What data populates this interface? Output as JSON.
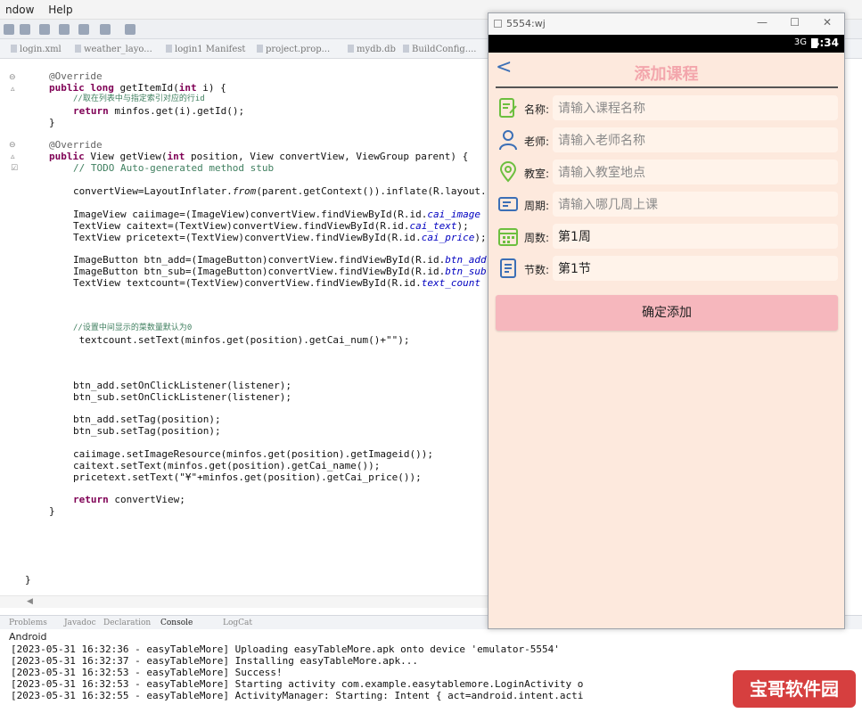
{
  "menu": [
    "ndow",
    "Help"
  ],
  "editor_tabs": [
    "login.xml",
    "weather_layo...",
    "login1 Manifest",
    "project.prop...",
    "mydb.db",
    "BuildConfig...."
  ],
  "code": {
    "l1": "@Override",
    "l2a": "public long ",
    "l2b": "getItemId(",
    "l2c": "int",
    "l2d": " i) {",
    "l3": "//取在列表中与指定索引对应的行id",
    "l4a": "return",
    "l4b": " minfos.get(i).getId();",
    "l5": "}",
    "l6": "@Override",
    "l7a": "public",
    "l7b": " View getView(",
    "l7c": "int",
    "l7d": " position, View convertView, ViewGroup parent) {",
    "l8": "// TODO Auto-generated method stub",
    "l9a": "convertView=LayoutInflater.",
    "l9b": "from",
    "l9c": "(parent.getContext()).inflate(R.layout.",
    "l10a": "ImageView caiimage=(ImageView)convertView.findViewById(R.id.",
    "l10b": "cai_image",
    "l11a": "TextView caitext=(TextView)convertView.findViewById(R.id.",
    "l11b": "cai_text",
    "l11c": ");",
    "l12a": "TextView pricetext=(TextView)convertView.findViewById(R.id.",
    "l12b": "cai_price",
    "l12c": ");",
    "l13a": "ImageButton btn_add=(ImageButton)convertView.findViewById(R.id.",
    "l13b": "btn_add",
    "l14a": "ImageButton btn_sub=(ImageButton)convertView.findViewById(R.id.",
    "l14b": "btn_sub",
    "l15a": "TextView textcount=(TextView)convertView.findViewById(R.id.",
    "l15b": "text_count",
    "l16": "//设置中间显示的菜数量默认为0",
    "l17": " textcount.setText(minfos.get(position).getCai_num()+\"\");",
    "l18": "btn_add.setOnClickListener(listener);",
    "l19": "btn_sub.setOnClickListener(listener);",
    "l20": "btn_add.setTag(position);",
    "l21": "btn_sub.setTag(position);",
    "l22": "caiimage.setImageResource(minfos.get(position).getImageid());",
    "l23": "caitext.setText(minfos.get(position).getCai_name());",
    "l24": "pricetext.setText(\"¥\"+minfos.get(position).getCai_price());",
    "l25a": "return",
    "l25b": " convertView;",
    "l26": "}",
    "l27": "}"
  },
  "console_tabs": [
    "Problems",
    "Javadoc",
    "Declaration",
    "Console",
    "LogCat"
  ],
  "console_header": "Android",
  "console_lines": [
    "[2023-05-31 16:32:36 - easyTableMore] Uploading easyTableMore.apk onto device 'emulator-5554'",
    "[2023-05-31 16:32:37 - easyTableMore] Installing easyTableMore.apk...",
    "[2023-05-31 16:32:53 - easyTableMore] Success!",
    "[2023-05-31 16:32:53 - easyTableMore] Starting activity com.example.easytablemore.LoginActivity o",
    "[2023-05-31 16:32:55 - easyTableMore] ActivityManager: Starting: Intent { act=android.intent.acti"
  ],
  "emulator": {
    "window_title": "5554:wj",
    "min": "—",
    "max": "☐",
    "close": "✕",
    "signal": "3G",
    "time": "4:34",
    "page_title": "添加课程",
    "fields": [
      {
        "label": "名称:",
        "value": "请输入课程名称",
        "placeholder": true
      },
      {
        "label": "老师:",
        "value": "请输入老师名称",
        "placeholder": true
      },
      {
        "label": "教室:",
        "value": "请输入教室地点",
        "placeholder": true
      },
      {
        "label": "周期:",
        "value": "请输入哪几周上课",
        "placeholder": true
      },
      {
        "label": "周数:",
        "value": "第1周",
        "placeholder": false
      },
      {
        "label": "节数:",
        "value": "第1节",
        "placeholder": false
      }
    ],
    "confirm_label": "确定添加"
  },
  "watermark": "宝哥软件园",
  "colors": {
    "accent": "#f6b7bd",
    "screen_bg": "#fde9dd",
    "icon_green": "#6cbf3f",
    "icon_blue": "#3b6fb6"
  }
}
